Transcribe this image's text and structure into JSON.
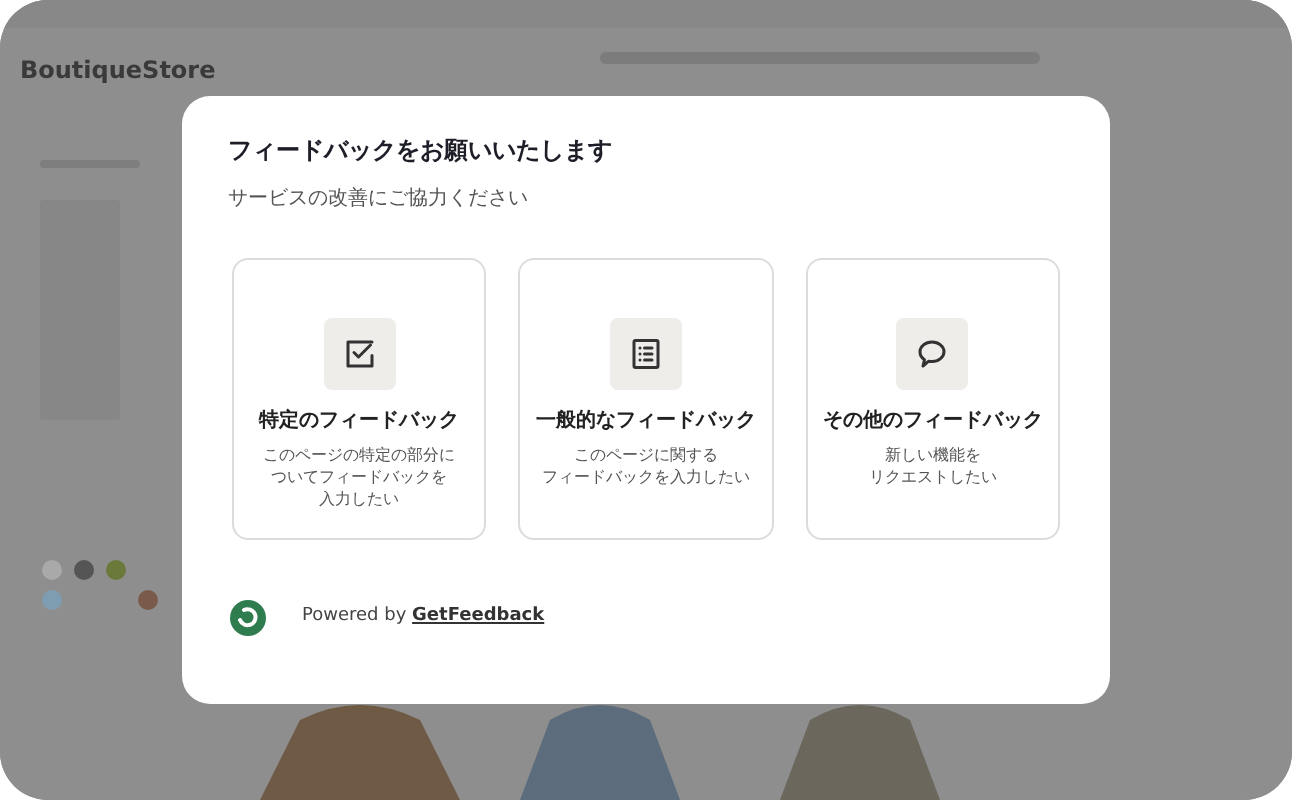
{
  "background": {
    "logo": "BoutiqueStore"
  },
  "modal": {
    "title": "フィードバックをお願いいたします",
    "subtitle": "サービスの改善にご協力ください",
    "options": [
      {
        "kind": "checkbox",
        "title": "特定のフィードバック",
        "description": [
          "このページの特定の部分に",
          "ついてフィードバックを",
          "入力したい"
        ]
      },
      {
        "kind": "list",
        "title": "一般的なフィードバック",
        "description": [
          "このページに関する",
          "フィードバックを入力したい"
        ]
      },
      {
        "kind": "speech",
        "title": "その他のフィードバック",
        "description": [
          "新しい機能を",
          "リクエストしたい"
        ]
      }
    ],
    "footer": {
      "powered_by": "Powered by",
      "brand": "GetFeedback"
    }
  }
}
